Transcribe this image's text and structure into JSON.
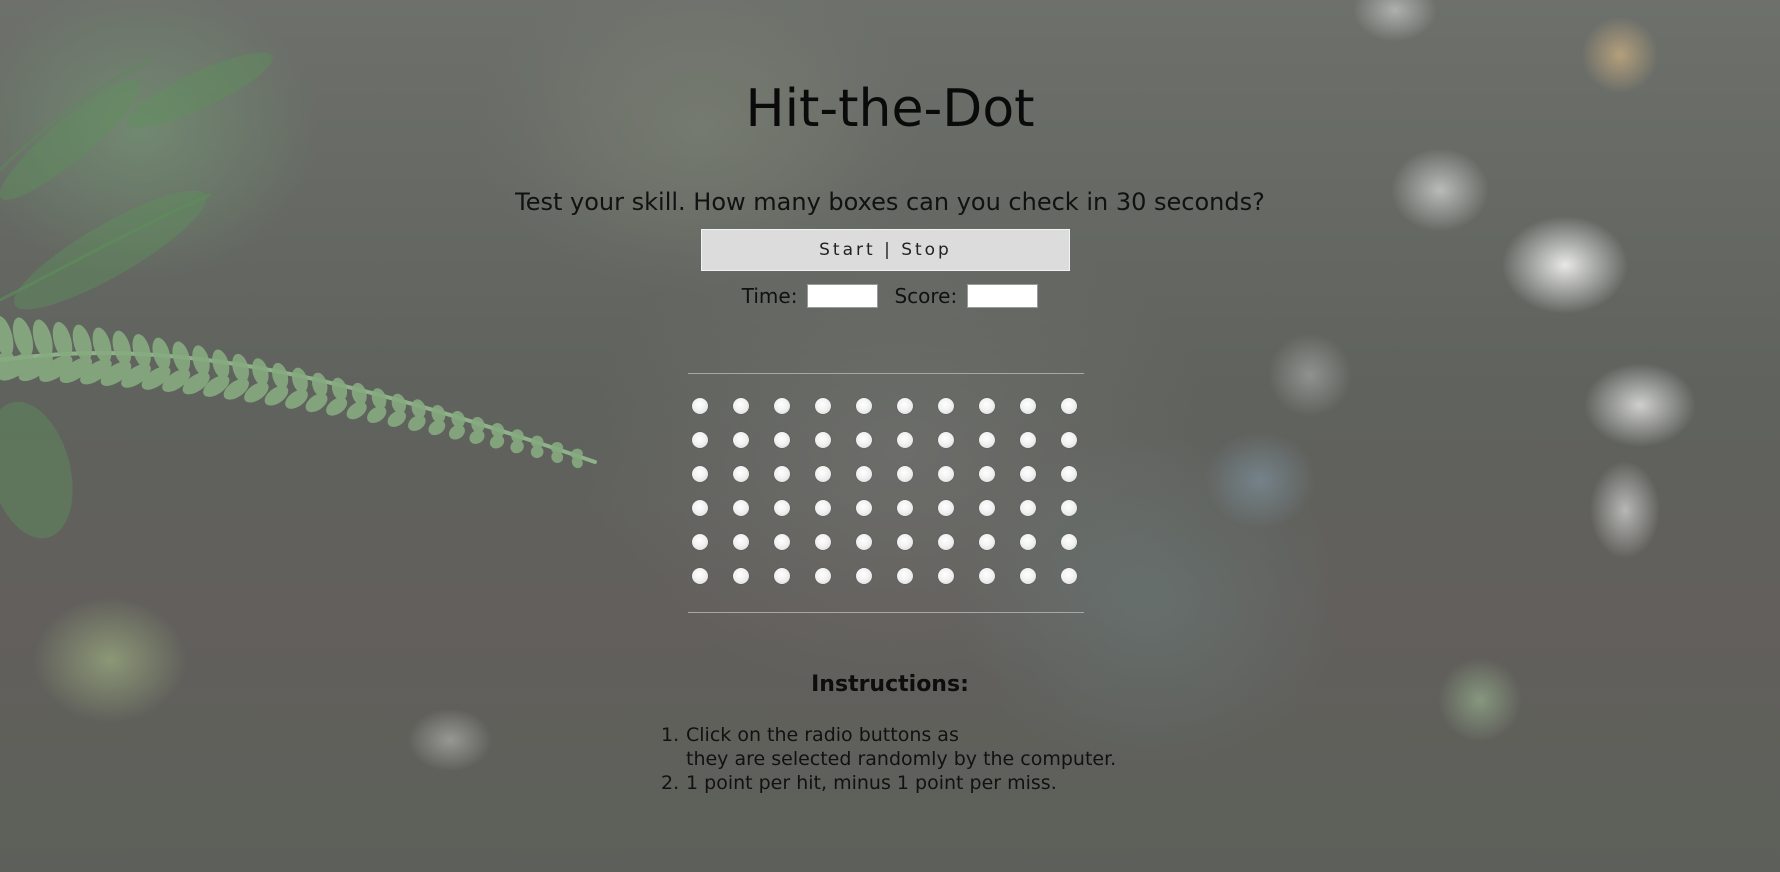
{
  "page": {
    "title": "Hit-the-Dot",
    "subtitle": "Test your skill. How many boxes can you check in 30 seconds?"
  },
  "controls": {
    "start_stop_label": "Start | Stop",
    "time_label": "Time:",
    "time_value": "",
    "score_label": "Score:",
    "score_value": ""
  },
  "dot_grid": {
    "rows": 6,
    "columns": 10
  },
  "instructions": {
    "heading": "Instructions:",
    "items": [
      {
        "number": "1.",
        "lines": [
          "Click on the radio buttons as",
          "they are selected randomly by the computer."
        ]
      },
      {
        "number": "2.",
        "lines": [
          "1 point per hit, minus 1 point per miss."
        ]
      }
    ]
  },
  "colors": {
    "button_background": "#dcdcdc",
    "field_background": "#ffffff",
    "dot": "#eeeeee",
    "text": "#111111"
  }
}
